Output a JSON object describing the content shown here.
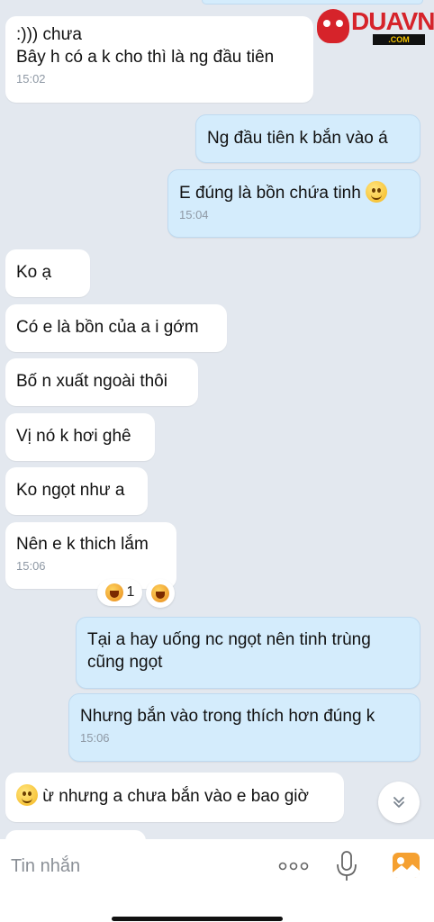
{
  "watermark": {
    "brand": "DUAVN",
    "domain": ".COM"
  },
  "messages": [
    {
      "id": "m1",
      "side": "in",
      "lines": [
        ":))) chưa",
        "Bây h có a k cho thì là ng đầu tiên"
      ],
      "time": "15:02"
    },
    {
      "id": "m2",
      "side": "out",
      "lines": [
        "Ng đầu tiên k bắn vào á"
      ]
    },
    {
      "id": "m3",
      "side": "out",
      "lines": [
        "E đúng là bồn chứa tinh"
      ],
      "emoji": "smiling-face",
      "time": "15:04"
    },
    {
      "id": "m4",
      "side": "in",
      "lines": [
        "Ko ạ"
      ]
    },
    {
      "id": "m5",
      "side": "in",
      "lines": [
        "Có e là bồn của a i gớm"
      ]
    },
    {
      "id": "m6",
      "side": "in",
      "lines": [
        "Bố n xuất ngoài thôi"
      ]
    },
    {
      "id": "m7",
      "side": "in",
      "lines": [
        "Vị nó k hơi ghê"
      ]
    },
    {
      "id": "m8",
      "side": "in",
      "lines": [
        "Ko ngọt như a"
      ]
    },
    {
      "id": "m9",
      "side": "in",
      "lines": [
        "Nên e k thich lắm"
      ],
      "time": "15:06",
      "reaction": {
        "emoji": "laughing-face",
        "count": "1"
      }
    },
    {
      "id": "m10",
      "side": "out",
      "lines": [
        "Tại a hay uống nc ngọt nên tinh trùng",
        "cũng ngọt"
      ]
    },
    {
      "id": "m11",
      "side": "out",
      "lines": [
        "Nhưng bắn vào trong thích hơn đúng k"
      ],
      "time": "15:06"
    },
    {
      "id": "m12",
      "side": "in",
      "lines": [
        "ừ nhưng a chưa bắn vào e bao giờ"
      ],
      "emoji": "smiling-face"
    }
  ],
  "composer": {
    "placeholder": "Tin nhắn",
    "icons": [
      "more-options-icon",
      "microphone-icon",
      "image-icon"
    ]
  },
  "colors": {
    "background": "#e3e8ef",
    "incoming_bubble": "#ffffff",
    "outgoing_bubble": "#d4ecfc",
    "time_text": "#8e98a4",
    "accent_orange": "#f5a030"
  }
}
